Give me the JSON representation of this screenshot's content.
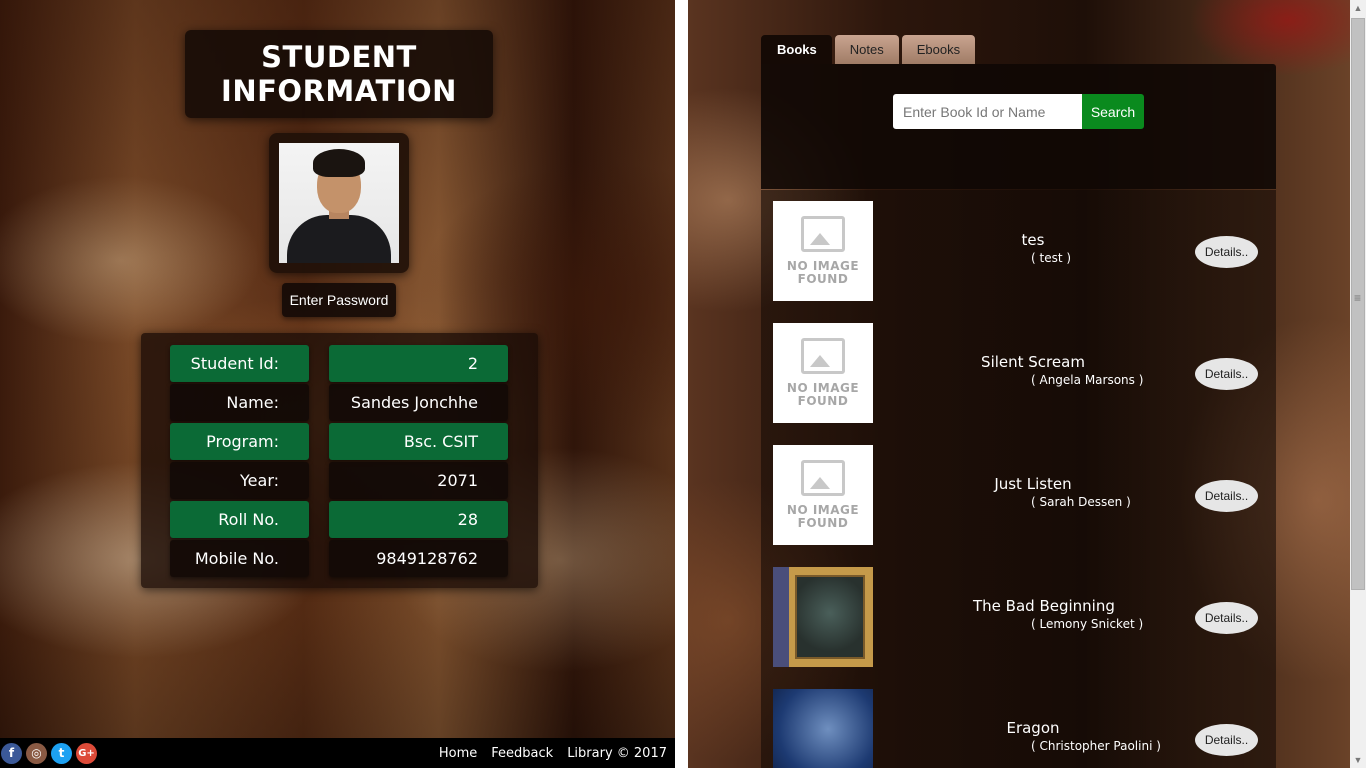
{
  "student": {
    "title_line1": "STUDENT",
    "title_line2": "INFORMATION",
    "password_button": "Enter Password",
    "fields": [
      {
        "label": "Student Id:",
        "value": "2"
      },
      {
        "label": "Name:",
        "value": "Sandes Jonchhe"
      },
      {
        "label": "Program:",
        "value": "Bsc. CSIT"
      },
      {
        "label": "Year:",
        "value": "2071"
      },
      {
        "label": "Roll No.",
        "value": "28"
      },
      {
        "label": "Mobile No.",
        "value": "9849128762"
      }
    ]
  },
  "footer": {
    "social": [
      "facebook-icon",
      "instagram-icon",
      "twitter-icon",
      "google-plus-icon"
    ],
    "links": [
      "Home",
      "Feedback",
      "Library © 2017"
    ]
  },
  "library": {
    "tabs": [
      {
        "label": "Books",
        "active": true
      },
      {
        "label": "Notes",
        "active": false
      },
      {
        "label": "Ebooks",
        "active": false
      }
    ],
    "search": {
      "placeholder": "Enter Book Id or Name",
      "button": "Search"
    },
    "no_image_line1": "NO IMAGE",
    "no_image_line2": "FOUND",
    "details_label": "Details..",
    "books": [
      {
        "title": "tes",
        "author": "( test )",
        "cover": "none"
      },
      {
        "title": "Silent Scream",
        "author": "( Angela Marsons )",
        "cover": "none"
      },
      {
        "title": "Just Listen",
        "author": "( Sarah Dessen )",
        "cover": "none"
      },
      {
        "title": "The Bad Beginning",
        "author": "( Lemony Snicket )",
        "cover": "bad-beginning"
      },
      {
        "title": "Eragon",
        "author": "( Christopher Paolini )",
        "cover": "eragon"
      }
    ]
  },
  "colors": {
    "green_cell": "#0b6a36",
    "search_button": "#0a8a1e",
    "active_tab": "#150a05"
  }
}
